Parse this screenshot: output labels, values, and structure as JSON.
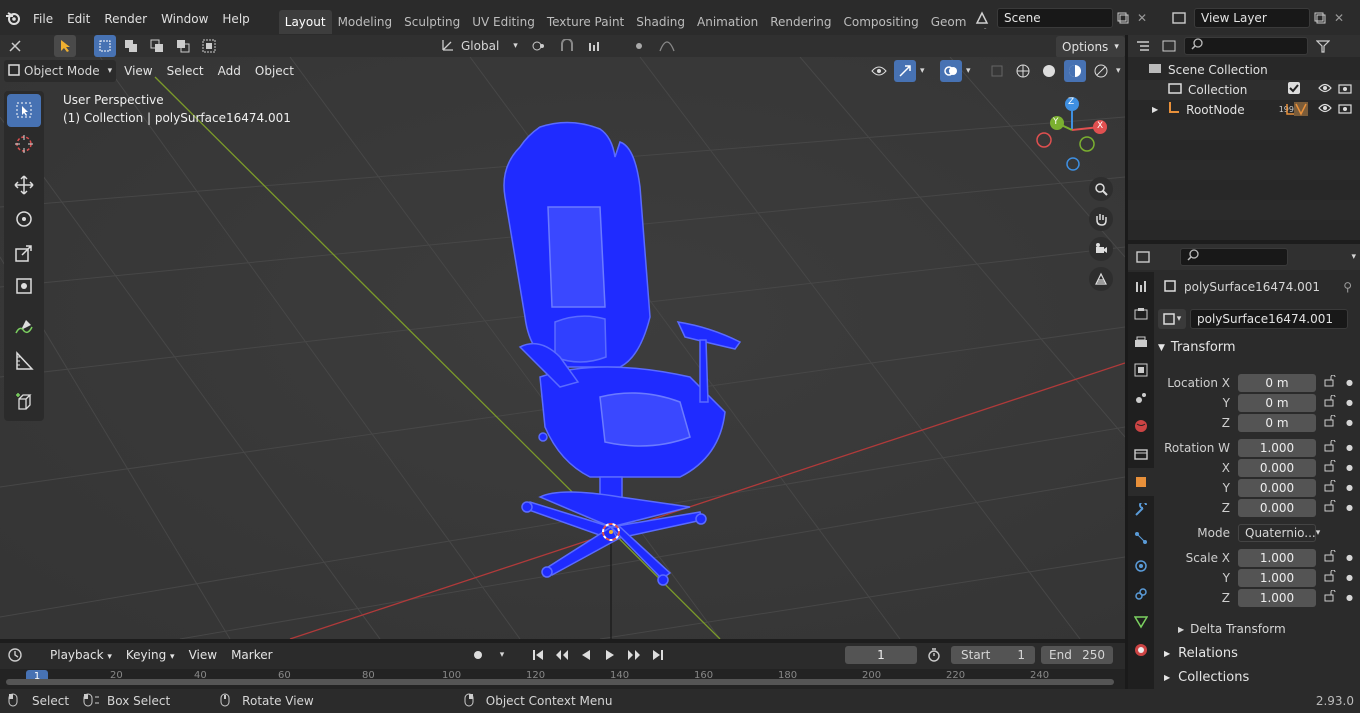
{
  "menu": {
    "file": "File",
    "edit": "Edit",
    "render": "Render",
    "window": "Window",
    "help": "Help"
  },
  "workspaces": [
    "Layout",
    "Modeling",
    "Sculpting",
    "UV Editing",
    "Texture Paint",
    "Shading",
    "Animation",
    "Rendering",
    "Compositing",
    "Geometry Nod"
  ],
  "scene": {
    "value": "Scene"
  },
  "view_layer": {
    "value": "View Layer"
  },
  "header": {
    "orientation": "Global",
    "options": "Options",
    "mode": "Object Mode",
    "view": "View",
    "select": "Select",
    "add": "Add",
    "object": "Object"
  },
  "viewport": {
    "perspective": "User Perspective",
    "collection_info": "(1) Collection | polySurface16474.001",
    "gizmo": {
      "x": "X",
      "y": "Y",
      "z": "Z"
    }
  },
  "outliner": {
    "scene_collection": "Scene Collection",
    "collection": "Collection",
    "root_node": "RootNode",
    "badge": "199"
  },
  "properties": {
    "object_name": "polySurface16474.001",
    "datablock": "polySurface16474.001",
    "transform": "Transform",
    "location": {
      "label_x": "Location X",
      "label_y": "Y",
      "label_z": "Z",
      "x": "0 m",
      "y": "0 m",
      "z": "0 m"
    },
    "rotation": {
      "label_w": "Rotation W",
      "label_x": "X",
      "label_y": "Y",
      "label_z": "Z",
      "w": "1.000",
      "x": "0.000",
      "y": "0.000",
      "z": "0.000"
    },
    "mode_label": "Mode",
    "mode_value": "Quaternio...",
    "scale": {
      "label_x": "Scale X",
      "label_y": "Y",
      "label_z": "Z",
      "x": "1.000",
      "y": "1.000",
      "z": "1.000"
    },
    "delta": "Delta Transform",
    "relations": "Relations",
    "collections": "Collections"
  },
  "timeline": {
    "playback": "Playback",
    "keying": "Keying",
    "view": "View",
    "marker": "Marker",
    "current_frame": "1",
    "start_label": "Start",
    "start": "1",
    "end_label": "End",
    "end": "250",
    "ruler": [
      "1",
      "20",
      "40",
      "60",
      "80",
      "100",
      "120",
      "140",
      "160",
      "180",
      "200",
      "220",
      "240"
    ]
  },
  "status": {
    "select": "Select",
    "box_select": "Box Select",
    "rotate_view": "Rotate View",
    "context_menu": "Object Context Menu",
    "version": "2.93.0"
  },
  "colors": {
    "accent": "#4772b3",
    "chair": "#1f2bff",
    "grid_x": "#b03a3a",
    "grid_y": "#7b9a2a"
  }
}
